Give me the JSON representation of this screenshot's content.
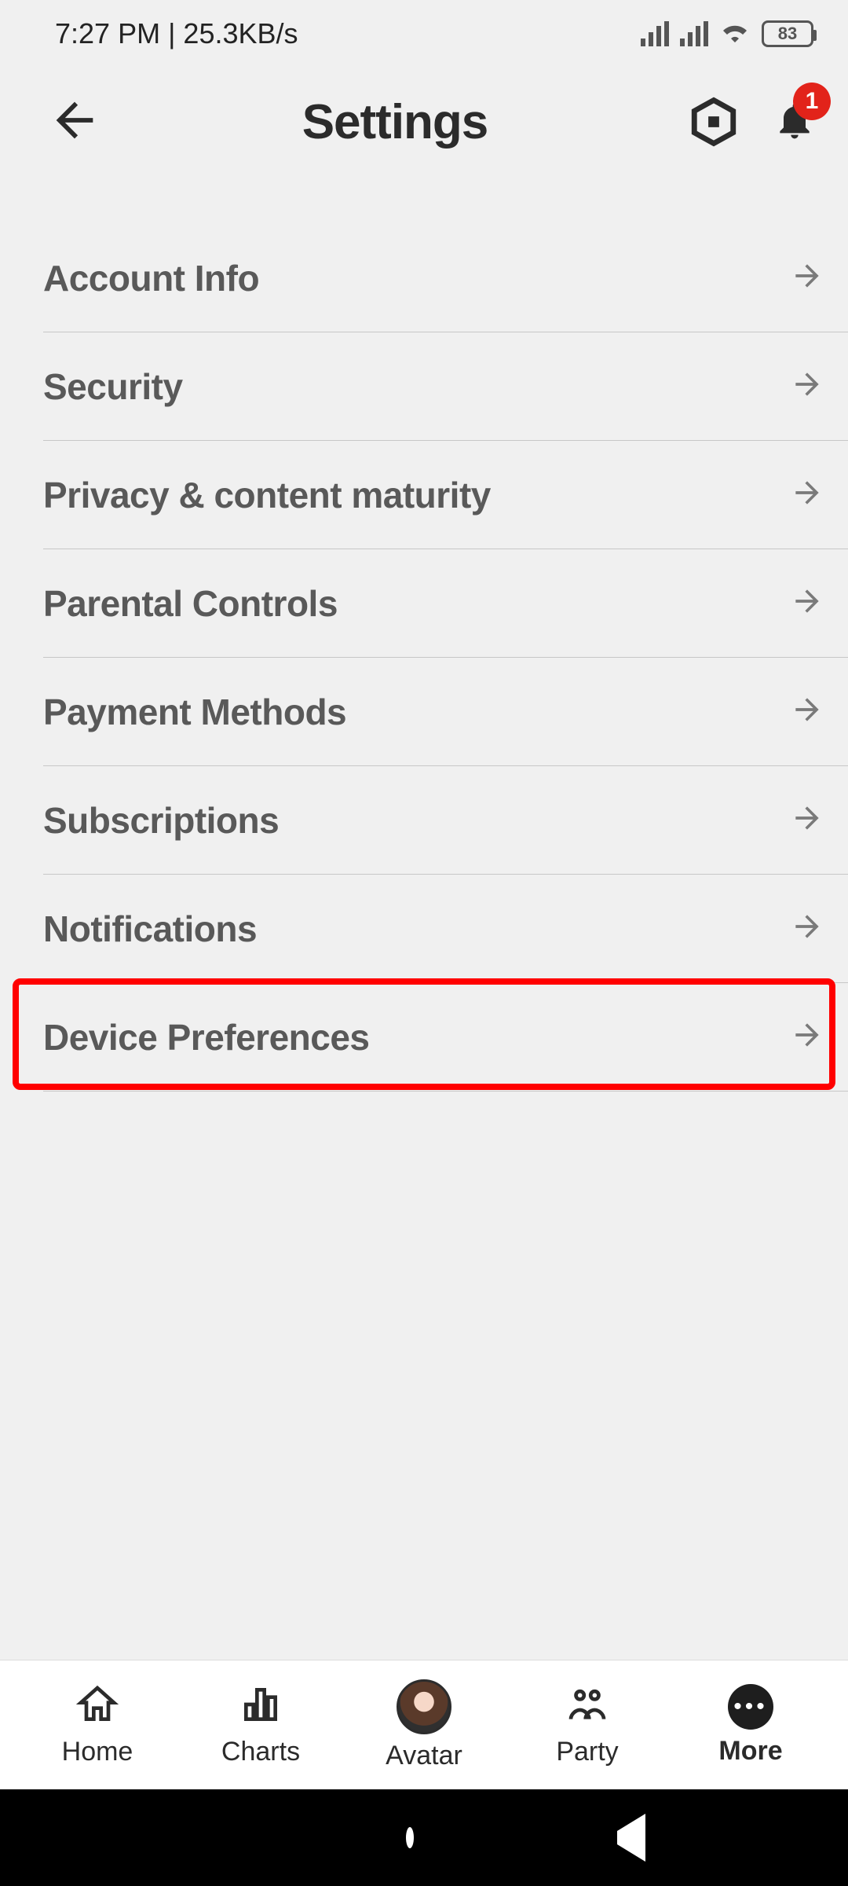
{
  "status": {
    "time": "7:27 PM | 25.3KB/s",
    "battery": "83"
  },
  "header": {
    "title": "Settings",
    "notification_count": "1"
  },
  "settings": {
    "items": [
      {
        "key": "account-info",
        "label": "Account Info"
      },
      {
        "key": "security",
        "label": "Security"
      },
      {
        "key": "privacy",
        "label": "Privacy & content maturity"
      },
      {
        "key": "parental-controls",
        "label": "Parental Controls"
      },
      {
        "key": "payment-methods",
        "label": "Payment Methods"
      },
      {
        "key": "subscriptions",
        "label": "Subscriptions"
      },
      {
        "key": "notifications",
        "label": "Notifications"
      },
      {
        "key": "device-preferences",
        "label": "Device Preferences"
      }
    ],
    "highlighted_index": 7
  },
  "bottom_nav": {
    "items": [
      {
        "key": "home",
        "label": "Home"
      },
      {
        "key": "charts",
        "label": "Charts"
      },
      {
        "key": "avatar",
        "label": "Avatar"
      },
      {
        "key": "party",
        "label": "Party"
      },
      {
        "key": "more",
        "label": "More"
      }
    ],
    "active_key": "more"
  }
}
